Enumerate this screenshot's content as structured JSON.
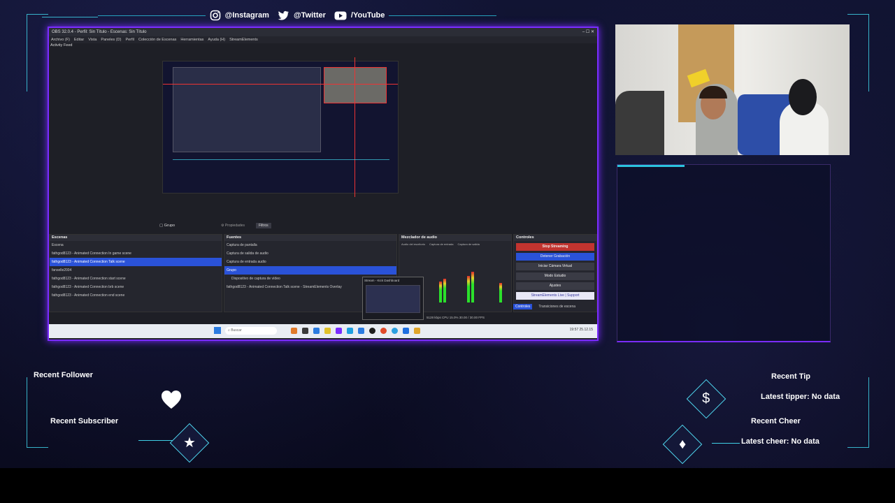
{
  "social": {
    "instagram": "@Instagram",
    "twitter": "@Twitter",
    "youtube": "/YouTube"
  },
  "obs": {
    "window_title": "OBS 32.0.4 - Perfil: Sin Título - Escenas: Sin Título",
    "menu": [
      "Archivo (F)",
      "Editar",
      "Vista",
      "Paneles (D)",
      "Perfil",
      "Colección de Escenas",
      "Herramientas",
      "Ayuda (H)",
      "StreamElements"
    ],
    "dock_activity": "Activity Feed",
    "scene_label": "Grupo",
    "props_btn": "Propiedades",
    "filters_btn": "Filtros",
    "scenes_title": "Escenas",
    "scenes": [
      "Escena",
      "fathgod8123 - Animated Connection In game scene",
      "fathgod8123 - Animated Connection Talk scene",
      "fanselle2004",
      "fathgod8123 - Animated Connection start scene",
      "fathgod8123 - Animated Connection brb scene",
      "fathgod8123 - Animated Connection end scene"
    ],
    "sources_title": "Fuentes",
    "sources": [
      "Captura de pantalla",
      "Captura de salida de audio",
      "Captura de entrada audio",
      "Grupo",
      "Dispositivo de captura de vídeo",
      "fathgod8123 - Animated Connection Talk scene - StreamElements Overlay"
    ],
    "mixer_title": "Mezclador de audio",
    "mixer_channels": [
      "Audio del escritorio",
      "Captura de entrada",
      "Captura de salida"
    ],
    "controls_title": "Controles",
    "controls": [
      "Stop Streaming",
      "Detener Grabación",
      "Iniciar Cámara Virtual",
      "Modo Estudio",
      "Ajustes",
      "StreamElements Live | Support"
    ],
    "control_tabs": [
      "Controles",
      "Transiciones de escena"
    ],
    "popup_title": "Stream - Kick Dashboard",
    "status": "5128 kbps   CPU 15.0%   30.00 / 30.00 FPS",
    "clock": "19:57   25.12.15"
  },
  "alerts": {
    "recent_follower": "Recent Follower",
    "recent_subscriber": "Recent Subscriber",
    "recent_tip": "Recent Tip",
    "latest_tipper": "Latest tipper: No data",
    "recent_cheer": "Recent Cheer",
    "latest_cheer": "Latest cheer: No data"
  },
  "colors": {
    "accent_cyan": "#3fd0e6",
    "accent_purple": "#7a2cff",
    "obs_selected": "#2a52d8",
    "stop_streaming": "#c2342f"
  }
}
